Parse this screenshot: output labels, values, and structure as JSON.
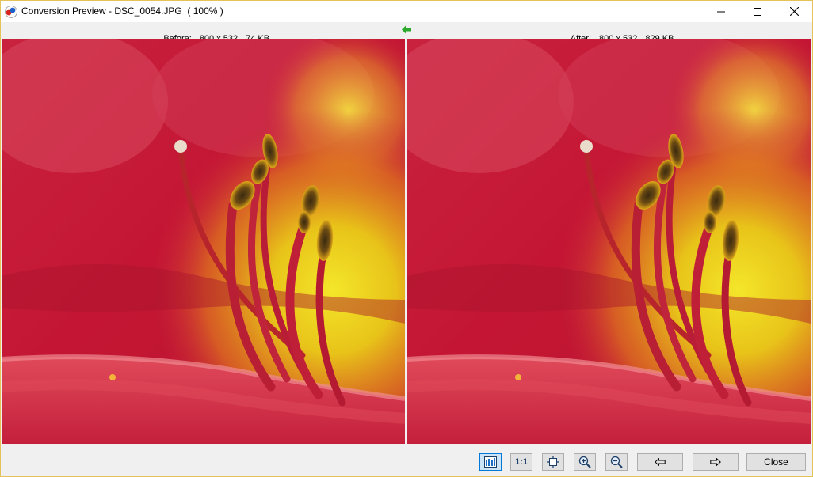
{
  "window": {
    "title": "Conversion Preview - DSC_0054.JPG  ( 100% )",
    "controls": {
      "minimize": "minimize",
      "maximize": "maximize",
      "close": "close"
    }
  },
  "info": {
    "before": {
      "label": "Before:",
      "dimensions": "800 x 532",
      "size": "74 KB"
    },
    "after": {
      "label": "After:",
      "dimensions": "800 x 532",
      "size": "829 KB"
    }
  },
  "panes": {
    "before": {
      "image": "red-lily-stamens-photo"
    },
    "after": {
      "image": "red-lily-stamens-photo"
    }
  },
  "toolbar": {
    "compare_icon": "side-by-side-icon",
    "one_to_one_label": "1:1",
    "fit_icon": "fit-to-window-icon",
    "zoom_in_icon": "zoom-in-icon",
    "zoom_out_icon": "zoom-out-icon",
    "prev_icon": "arrow-left-icon",
    "next_icon": "arrow-right-icon",
    "close_label": "Close"
  },
  "colors": {
    "accent": "#0078d7",
    "sync_arrow": "#2da92d",
    "border": "#e3c35a"
  }
}
